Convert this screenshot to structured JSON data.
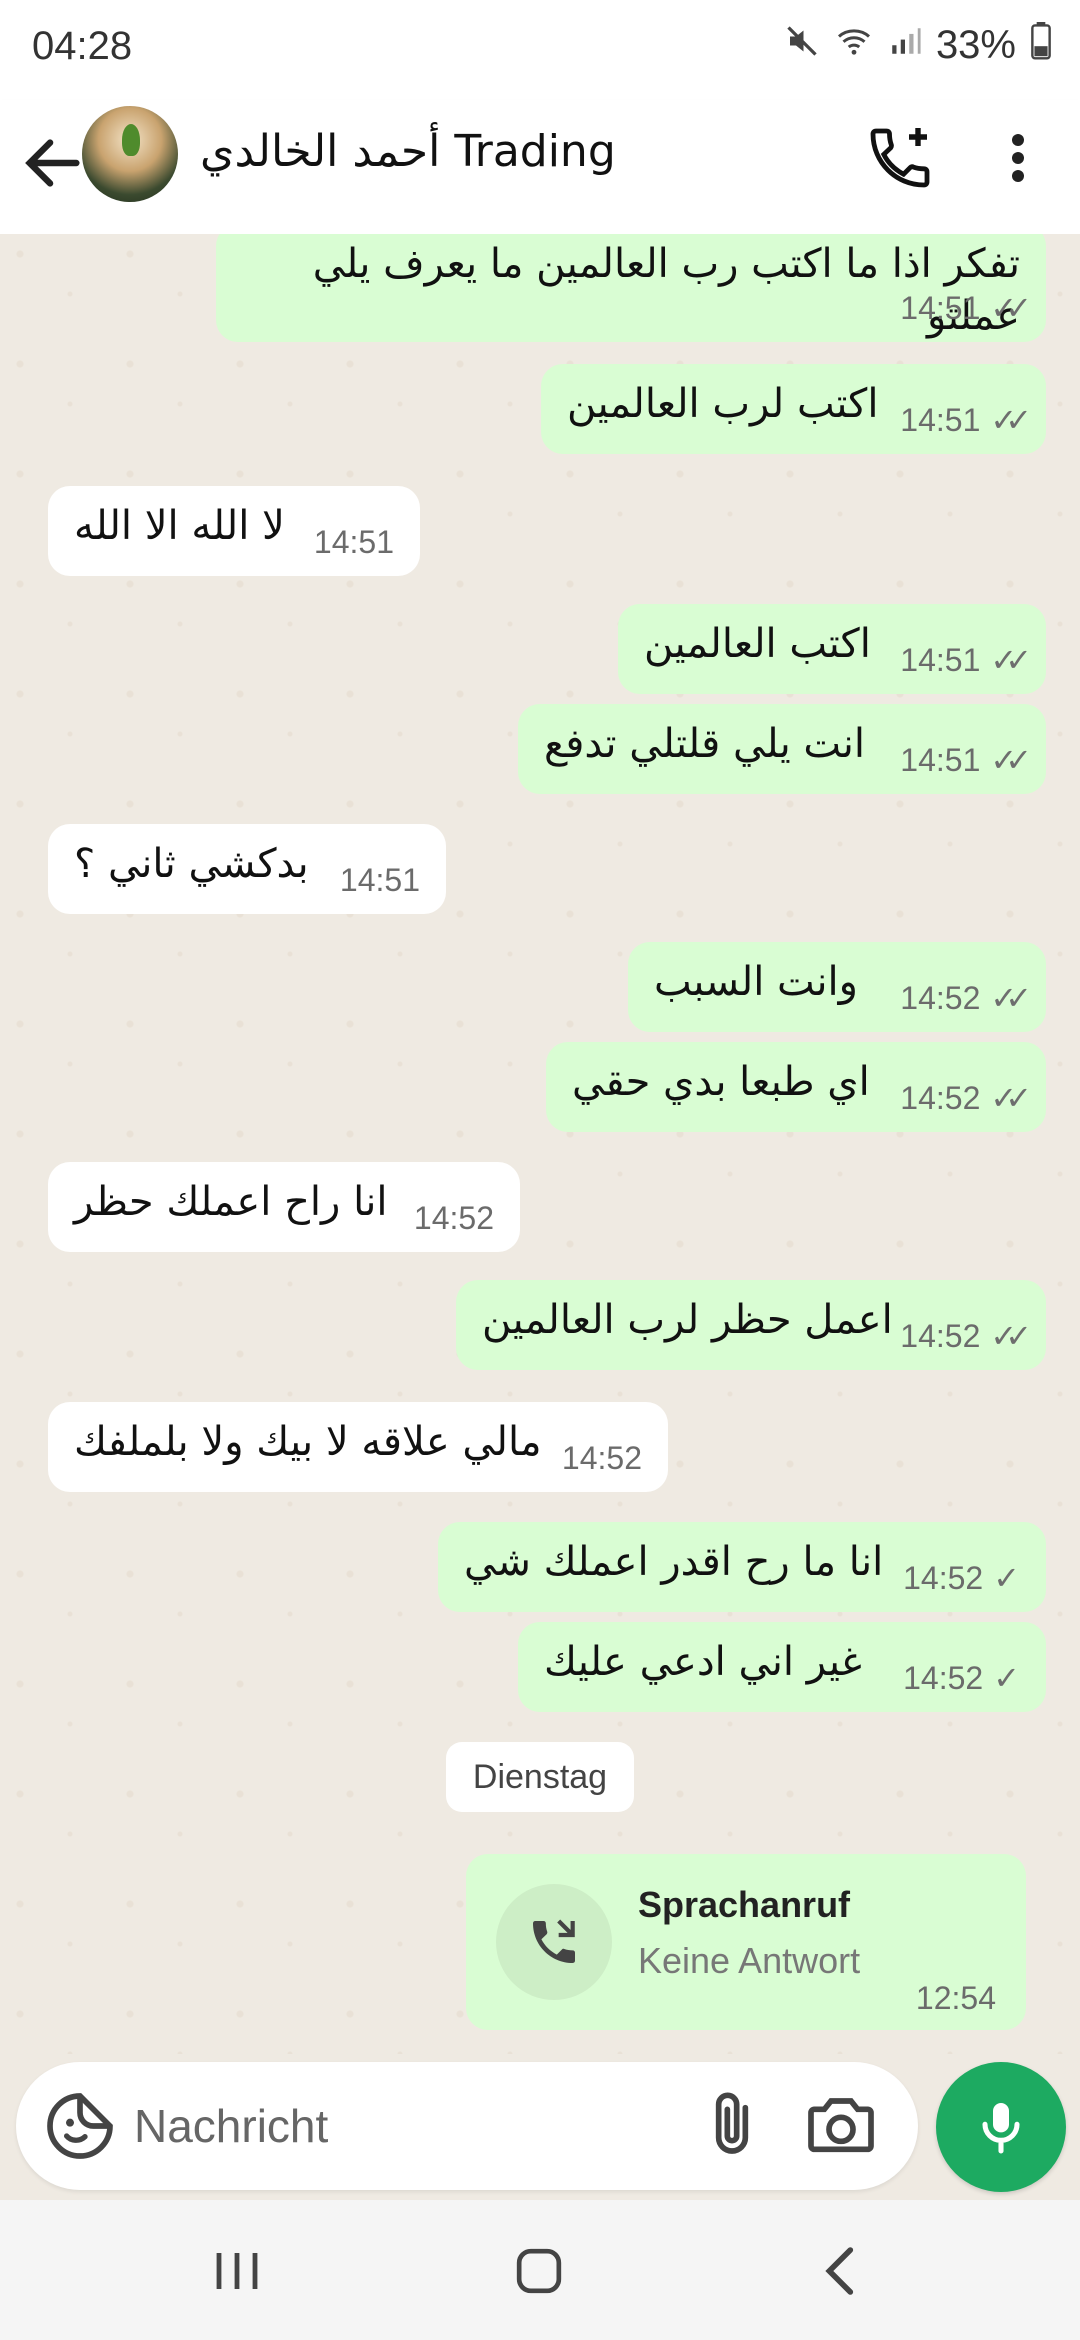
{
  "status_bar": {
    "time": "04:28",
    "battery": "33%"
  },
  "header": {
    "contact_name": "أحمد الخالدي Trading"
  },
  "messages": [
    {
      "dir": "out",
      "text": "تفكر اذا ما اكتب رب العالمين ما يعرف يلي عملتو",
      "time": "14:51",
      "status": "read"
    },
    {
      "dir": "out",
      "text": "اكتب لرب العالمين",
      "time": "14:51",
      "status": "read"
    },
    {
      "dir": "in",
      "text": "لا الله الا الله",
      "time": "14:51"
    },
    {
      "dir": "out",
      "text": "اكتب العالمين",
      "time": "14:51",
      "status": "read"
    },
    {
      "dir": "out",
      "text": "انت يلي قلتلي تدفع",
      "time": "14:51",
      "status": "read"
    },
    {
      "dir": "in",
      "text": "بدكشي ثاني ؟",
      "time": "14:51"
    },
    {
      "dir": "out",
      "text": "وانت السبب",
      "time": "14:52",
      "status": "read"
    },
    {
      "dir": "out",
      "text": "اي طبعا بدي حقي",
      "time": "14:52",
      "status": "read"
    },
    {
      "dir": "in",
      "text": "انا راح اعملك حظر",
      "time": "14:52"
    },
    {
      "dir": "out",
      "text": "اعمل حظر لرب العالمين",
      "time": "14:52",
      "status": "read"
    },
    {
      "dir": "in",
      "text": "مالي علاقه لا بيك ولا بلملفك",
      "time": "14:52"
    },
    {
      "dir": "out",
      "text": "انا ما رح اقدر اعملك شي",
      "time": "14:52",
      "status": "sent"
    },
    {
      "dir": "out",
      "text": "غير اني ادعي عليك",
      "time": "14:52",
      "status": "sent"
    }
  ],
  "date_separator": "Dienstag",
  "call": {
    "title": "Sprachanruf",
    "subtitle": "Keine Antwort",
    "time": "12:54"
  },
  "composer": {
    "placeholder": "Nachricht"
  },
  "colors": {
    "outgoing": "#d9fdd3",
    "incoming": "#ffffff",
    "accent": "#1daa61"
  },
  "icons": [
    "back-arrow-icon",
    "add-call-icon",
    "more-vert-icon",
    "sticker-icon",
    "paperclip-icon",
    "camera-icon",
    "mic-icon",
    "phone-missed-icon"
  ]
}
